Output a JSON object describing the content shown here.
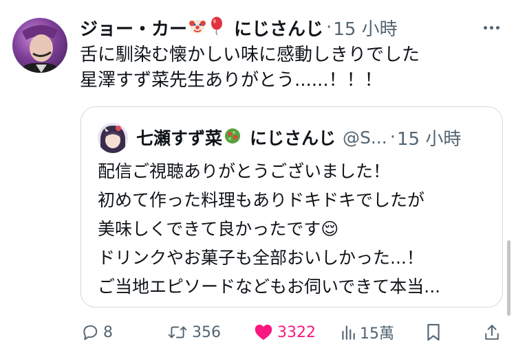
{
  "tweet": {
    "author_name": "ジョー・カー",
    "name_emojis": [
      "🤡",
      "🎈"
    ],
    "affiliation": "にじさんじ",
    "separator": "·",
    "time": "15 小時",
    "lines": [
      "舌に馴染む懐かしい味に感動しきりでした",
      "星澤すず菜先生ありがとう......！！！"
    ]
  },
  "quote": {
    "author_name": "七瀬すず菜",
    "name_emoji": "🥗",
    "affiliation": "にじさんじ",
    "handle": "@S...",
    "separator": "·",
    "time": "15 小時",
    "lines": [
      "配信ご視聴ありがとうございました！",
      "初めて作った料理もありドキドキでしたが",
      "美味しくできて良かったです😌",
      "ドリンクやお菓子も全部おいしかった...！",
      "ご当地エピソードなどもお伺いできて本当..."
    ]
  },
  "actions": {
    "reply_count": "8",
    "retweet_count": "356",
    "like_count": "3322",
    "view_count": "15萬"
  },
  "colors": {
    "text": "#0f1419",
    "secondary": "#536471",
    "like": "#f91880",
    "border": "#cfd9de"
  },
  "icons": [
    "more-icon",
    "reply-icon",
    "retweet-icon",
    "heart-icon",
    "views-icon",
    "bookmark-icon",
    "share-icon"
  ]
}
